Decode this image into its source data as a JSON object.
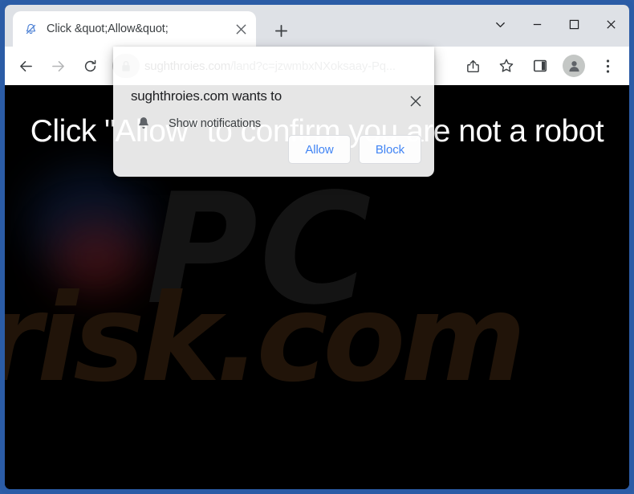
{
  "window": {
    "controls": [
      {
        "name": "tab-search",
        "icon": "chevron-down-icon",
        "label": "Search tabs"
      },
      {
        "name": "minimize",
        "icon": "minimize-icon",
        "label": "Minimize"
      },
      {
        "name": "maximize",
        "icon": "maximize-icon",
        "label": "Maximize"
      },
      {
        "name": "close",
        "icon": "close-icon",
        "label": "Close"
      }
    ],
    "border_color": "#2b5ca6"
  },
  "tab": {
    "title": "Click &quot;Allow&quot;",
    "favicon": "bell-slash-icon",
    "close_label": "Close tab",
    "new_tab_label": "New tab"
  },
  "toolbar": {
    "back_label": "Back",
    "forward_label": "Forward",
    "reload_label": "Reload",
    "site_icon": "lock-icon",
    "url_domain": "sughthroies.com",
    "url_path": "/land?c=jzwmbxNXoksaay-Pq...",
    "share_label": "Share this page",
    "bookmark_label": "Bookmark this tab",
    "side_panel_label": "Side panel",
    "profile_label": "Profile",
    "menu_label": "Customize and control Google Chrome"
  },
  "page": {
    "heading": "Click \"Allow\" to confirm you are not a robot",
    "watermark_top": "PC",
    "watermark_bottom": "risk.com",
    "background_color": "#000000"
  },
  "dialog": {
    "heading": "sughthroies.com wants to",
    "permission_icon": "bell-icon",
    "permission_label": "Show notifications",
    "allow_label": "Allow",
    "block_label": "Block",
    "close_label": "Close",
    "accent_color": "#4285f4"
  }
}
